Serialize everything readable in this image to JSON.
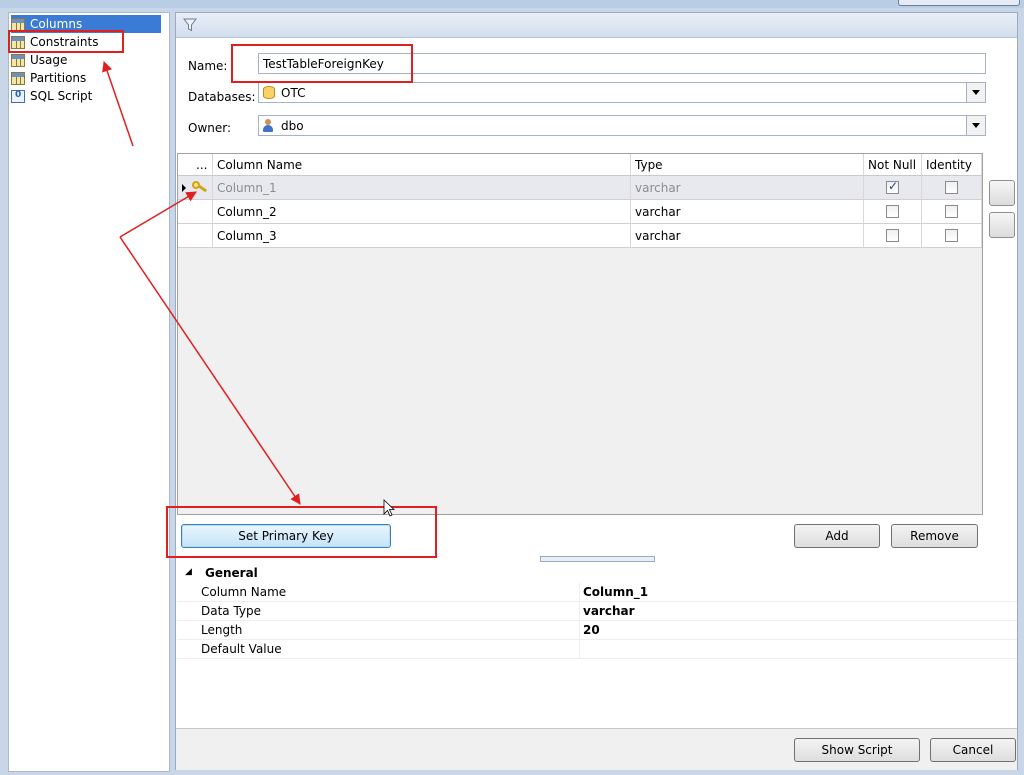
{
  "nav": {
    "items": [
      {
        "label": "Columns",
        "icon": "table-icon",
        "selected": true
      },
      {
        "label": "Constraints",
        "icon": "table-icon",
        "selected": false
      },
      {
        "label": "Usage",
        "icon": "table-icon",
        "selected": false
      },
      {
        "label": "Partitions",
        "icon": "table-icon",
        "selected": false
      },
      {
        "label": "SQL Script",
        "icon": "sql-script-icon",
        "selected": false
      }
    ]
  },
  "form": {
    "name_label": "Name:",
    "name_value": "TestTableForeignKey",
    "databases_label": "Databases:",
    "databases_value": "OTC",
    "owner_label": "Owner:",
    "owner_value": "dbo"
  },
  "grid": {
    "headers": [
      "...",
      "Column Name",
      "Type",
      "Not Null",
      "Identity"
    ],
    "rows": [
      {
        "name": "Column_1",
        "type": "varchar",
        "not_null": true,
        "identity": false,
        "primary_key": true,
        "selected": true
      },
      {
        "name": "Column_2",
        "type": "varchar",
        "not_null": false,
        "identity": false,
        "primary_key": false,
        "selected": false
      },
      {
        "name": "Column_3",
        "type": "varchar",
        "not_null": false,
        "identity": false,
        "primary_key": false,
        "selected": false
      }
    ]
  },
  "buttons": {
    "set_primary_key": "Set Primary Key",
    "add": "Add",
    "remove": "Remove",
    "show_script": "Show Script",
    "cancel": "Cancel"
  },
  "properties": {
    "section": "General",
    "rows": [
      {
        "name": "Column Name",
        "value": "Column_1"
      },
      {
        "name": "Data Type",
        "value": "varchar"
      },
      {
        "name": "Length",
        "value": "20"
      },
      {
        "name": "Default Value",
        "value": ""
      }
    ]
  },
  "colors": {
    "annotation": "#e02020",
    "nav_selected": "#3a7bd5"
  }
}
